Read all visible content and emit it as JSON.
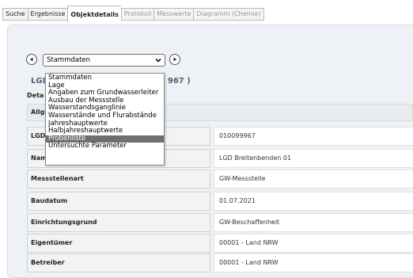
{
  "tabs": [
    {
      "label": "Suche",
      "state": "normal"
    },
    {
      "label": "Ergebnisse",
      "state": "normal"
    },
    {
      "label": "Objektdetails",
      "state": "active"
    },
    {
      "label": "Protokoll",
      "state": "disabled"
    },
    {
      "label": "Messwerte",
      "state": "disabled"
    },
    {
      "label": "Diagramm (Chemie)",
      "state": "disabled"
    }
  ],
  "nav": {
    "prev_icon": "chevron-left-icon",
    "next_icon": "chevron-right-icon"
  },
  "select": {
    "value": "Stammdaten",
    "icon": "chevron-down-icon"
  },
  "dropdown": {
    "options": [
      "Stammdaten",
      "Lage",
      "Angaben zum Grundwasserleiter",
      "Ausbau der Messstelle",
      "Wasserstandsganglinie",
      "Wasserstände und Flurabstände",
      "Jahreshauptwerte",
      "Halbjahreshauptwerte",
      "Probenliste",
      "Untersuchte Parameter"
    ],
    "highlighted": "Probenliste"
  },
  "header": {
    "title_left": "LGD",
    "title_right": "967 )",
    "details_label": "Deta",
    "section_label": "Allg"
  },
  "table": [
    {
      "label": "LGD",
      "value": "010099967"
    },
    {
      "label": "Nam",
      "value": "LGD Breitenbenden 01"
    },
    {
      "label": "Messstellenart",
      "value": "GW-Messstelle"
    },
    {
      "label": "Baudatum",
      "value": "01.07.2021"
    },
    {
      "label": "Einrichtungsgrund",
      "value": "GW-Beschaffenheit"
    },
    {
      "label": "Eigentümer",
      "value": "00001 - Land NRW"
    },
    {
      "label": "Betreiber",
      "value": "00001 - Land NRW"
    }
  ],
  "colors": {
    "highlight": "#6f6f6f",
    "panel": "#eef2f7",
    "title": "#4b5f7a"
  }
}
